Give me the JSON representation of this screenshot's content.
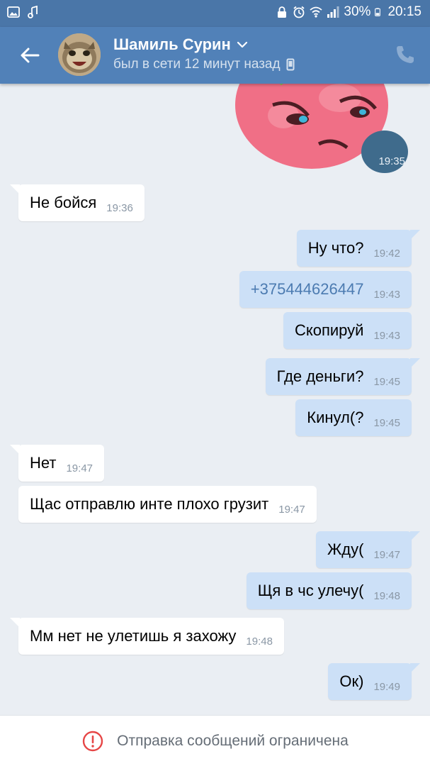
{
  "statusbar": {
    "battery": "30%",
    "clock": "20:15"
  },
  "header": {
    "contact_name": "Шамиль Сурин",
    "last_seen": "был в сети 12 минут назад"
  },
  "sticker": {
    "time": "19:35"
  },
  "messages": [
    {
      "dir": "in",
      "text": "Не бойся",
      "time": "19:36"
    },
    {
      "dir": "out",
      "text": "Ну что?",
      "time": "19:42"
    },
    {
      "dir": "out",
      "text": "+375444626447",
      "time": "19:43"
    },
    {
      "dir": "out",
      "text": "Скопируй",
      "time": "19:43"
    },
    {
      "dir": "out",
      "text": "Где деньги?",
      "time": "19:45"
    },
    {
      "dir": "out",
      "text": "Кинул(?",
      "time": "19:45"
    },
    {
      "dir": "in",
      "text": "Нет",
      "time": "19:47"
    },
    {
      "dir": "in",
      "text": "Щас отправлю инте плохо грузит",
      "time": "19:47"
    },
    {
      "dir": "out",
      "text": "Жду(",
      "time": "19:47"
    },
    {
      "dir": "out",
      "text": "Щя в чс улечу(",
      "time": "19:48"
    },
    {
      "dir": "in",
      "text": "Мм нет не улетишь я захожу",
      "time": "19:48"
    },
    {
      "dir": "out",
      "text": "Ок)",
      "time": "19:49"
    }
  ],
  "footer": {
    "notice": "Отправка сообщений ограничена"
  },
  "colors": {
    "header": "#5181b8",
    "statusbar": "#4a76a8",
    "chat_bg": "#eaeef3",
    "outgoing_bubble": "#cce0f7",
    "incoming_bubble": "#ffffff",
    "warning": "#e64646"
  },
  "icons": [
    "gallery-icon",
    "music-note-icon",
    "lock-icon",
    "alarm-icon",
    "wifi-icon",
    "signal-icon",
    "battery-icon",
    "back-arrow-icon",
    "chevron-down-icon",
    "mobile-phone-icon",
    "phone-call-icon",
    "warning-icon"
  ]
}
